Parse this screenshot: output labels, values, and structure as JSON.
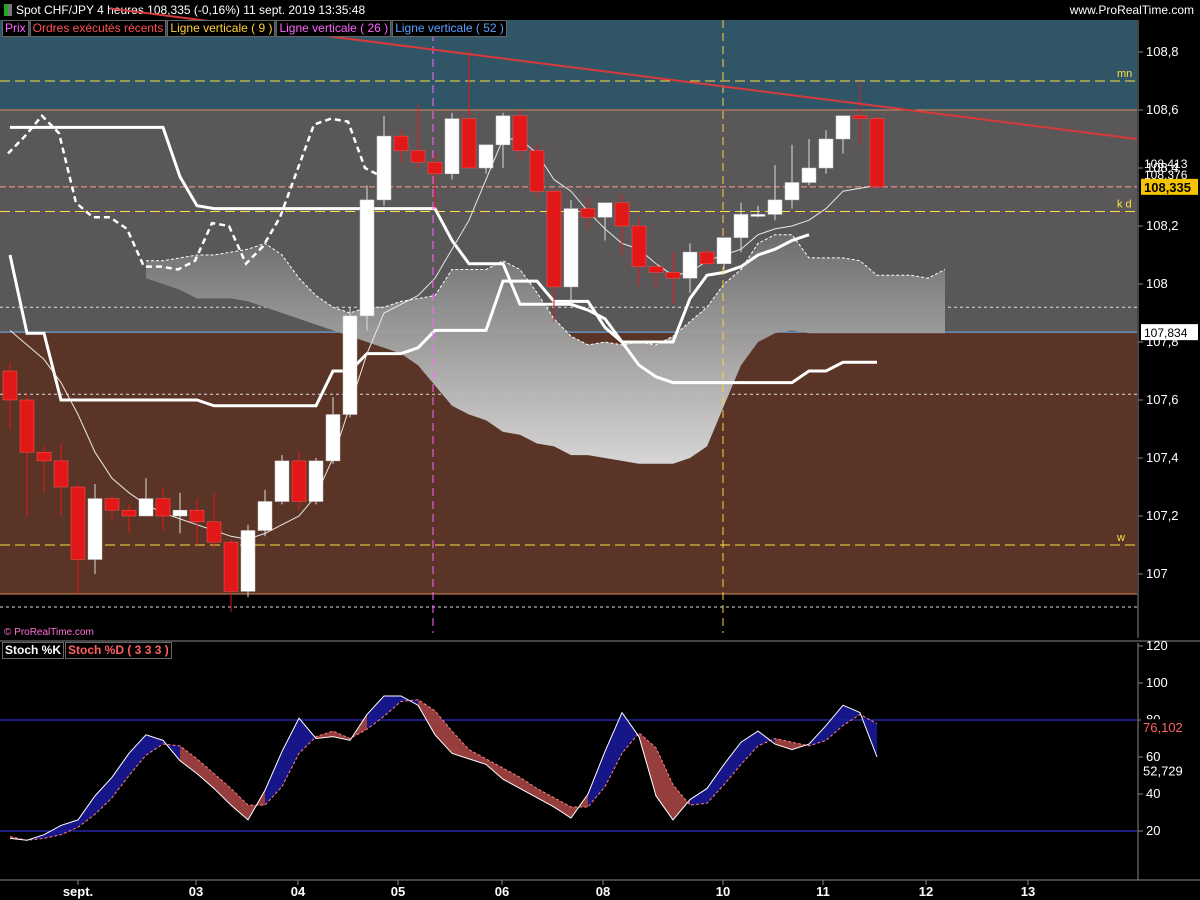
{
  "header": {
    "title": "Spot CHF/JPY   4 heures   108,335 (-0,16%)   11 sept. 2019 13:35:48",
    "site": "www.ProRealTime.com"
  },
  "legend": [
    {
      "label": "Prix",
      "color": "#ff66ff"
    },
    {
      "label": "Ordres exécutés récents",
      "color": "#ff5050"
    },
    {
      "label": "Ligne verticale ( 9 )",
      "color": "#ffd23c"
    },
    {
      "label": "Ligne verticale ( 26 )",
      "color": "#ff66ff"
    },
    {
      "label": "Ligne verticale ( 52 )",
      "color": "#5aa0ff"
    }
  ],
  "stoch_legend": [
    {
      "label": "Stoch %K",
      "color": "#ffffff"
    },
    {
      "label": "Stoch %D ( 3 3 3 )",
      "color": "#ff6060"
    }
  ],
  "copyright": "© ProRealTime.com",
  "colors": {
    "zone_top": "#2f5567",
    "zone_mid": "#595757",
    "zone_low": "#5a3426",
    "bull": "#ffffff",
    "bear": "#e21818",
    "trend": "#d83a3a"
  },
  "chart_data": [
    {
      "type": "candlestick",
      "title": "Spot CHF/JPY 4 heures",
      "ylim": [
        106.75,
        108.96
      ],
      "yticks": [
        "108,8",
        "108,6",
        "108,4",
        "108,2",
        "108",
        "107,8",
        "107,6",
        "107,4",
        "107,2",
        "107"
      ],
      "xticks": [
        "sept.",
        "03",
        "04",
        "05",
        "06",
        "08",
        "10",
        "11",
        "12",
        "13"
      ],
      "candles": [
        [
          107.7,
          107.73,
          107.5,
          107.6
        ],
        [
          107.6,
          107.62,
          107.2,
          107.42
        ],
        [
          107.42,
          107.44,
          107.28,
          107.39
        ],
        [
          107.39,
          107.45,
          107.2,
          107.3
        ],
        [
          107.3,
          107.31,
          106.93,
          107.05
        ],
        [
          107.05,
          107.31,
          107.0,
          107.26
        ],
        [
          107.26,
          107.27,
          107.18,
          107.22
        ],
        [
          107.22,
          107.24,
          107.14,
          107.2
        ],
        [
          107.2,
          107.33,
          107.2,
          107.26
        ],
        [
          107.26,
          107.3,
          107.15,
          107.2
        ],
        [
          107.2,
          107.28,
          107.14,
          107.22
        ],
        [
          107.22,
          107.26,
          107.1,
          107.18
        ],
        [
          107.18,
          107.28,
          107.09,
          107.11
        ],
        [
          107.11,
          107.12,
          106.87,
          106.94
        ],
        [
          106.94,
          107.17,
          106.92,
          107.15
        ],
        [
          107.15,
          107.29,
          107.13,
          107.25
        ],
        [
          107.25,
          107.41,
          107.24,
          107.39
        ],
        [
          107.39,
          107.42,
          107.22,
          107.25
        ],
        [
          107.25,
          107.4,
          107.24,
          107.39
        ],
        [
          107.39,
          107.61,
          107.38,
          107.55
        ],
        [
          107.55,
          107.92,
          107.54,
          107.89
        ],
        [
          107.89,
          108.34,
          107.84,
          108.29
        ],
        [
          108.29,
          108.58,
          108.27,
          108.51
        ],
        [
          108.51,
          108.53,
          108.42,
          108.46
        ],
        [
          108.46,
          108.62,
          108.4,
          108.42
        ],
        [
          108.42,
          108.45,
          108.26,
          108.38
        ],
        [
          108.38,
          108.59,
          108.36,
          108.57
        ],
        [
          108.57,
          108.81,
          108.41,
          108.4
        ],
        [
          108.4,
          108.48,
          108.38,
          108.48
        ],
        [
          108.48,
          108.59,
          108.4,
          108.58
        ],
        [
          108.58,
          108.6,
          108.43,
          108.46
        ],
        [
          108.46,
          108.48,
          108.3,
          108.32
        ],
        [
          108.32,
          108.33,
          107.87,
          107.99
        ],
        [
          107.99,
          108.29,
          107.94,
          108.26
        ],
        [
          108.26,
          108.3,
          108.19,
          108.23
        ],
        [
          108.23,
          108.28,
          108.15,
          108.28
        ],
        [
          108.28,
          108.31,
          108.1,
          108.2
        ],
        [
          108.2,
          108.23,
          107.99,
          108.06
        ],
        [
          108.06,
          108.07,
          107.99,
          108.04
        ],
        [
          108.04,
          108.11,
          107.93,
          108.02
        ],
        [
          108.02,
          108.14,
          107.97,
          108.11
        ],
        [
          108.11,
          108.12,
          108.06,
          108.07
        ],
        [
          108.07,
          108.16,
          108.05,
          108.16
        ],
        [
          108.16,
          108.28,
          108.11,
          108.24
        ],
        [
          108.24,
          108.27,
          108.23,
          108.24
        ],
        [
          108.24,
          108.41,
          108.22,
          108.29
        ],
        [
          108.29,
          108.48,
          108.26,
          108.35
        ],
        [
          108.35,
          108.5,
          108.34,
          108.4
        ],
        [
          108.4,
          108.53,
          108.38,
          108.5
        ],
        [
          108.5,
          108.58,
          108.45,
          108.58
        ],
        [
          108.58,
          108.7,
          108.48,
          108.57
        ],
        [
          108.57,
          108.58,
          108.33,
          108.335
        ]
      ],
      "levels": [
        {
          "label": "mn",
          "value": 108.7,
          "color": "#ffe040"
        },
        {
          "label": "k d",
          "value": 108.25,
          "color": "#ffe040"
        },
        {
          "label": "w",
          "value": 107.1,
          "color": "#ffe040"
        }
      ],
      "current_price": 108.335,
      "price_labels": [
        "108,413",
        "108,376",
        "108,335",
        "107,834"
      ]
    },
    {
      "type": "line",
      "title": "Stoch %K / Stoch %D ( 3 3 3 )",
      "ylim": [
        0,
        130
      ],
      "yticks": [
        "120",
        "100",
        "80",
        "60",
        "40",
        "20"
      ],
      "bands": [
        80,
        20
      ],
      "series": [
        {
          "name": "Stoch %K",
          "values": [
            16,
            15,
            18,
            23,
            26,
            39,
            49,
            62,
            72,
            69,
            58,
            51,
            43,
            34,
            26,
            42,
            63,
            81,
            70,
            71,
            69,
            83,
            93,
            93,
            88,
            72,
            62,
            59,
            56,
            48,
            43,
            38,
            33,
            27,
            40,
            63,
            84,
            71,
            39,
            26,
            37,
            43,
            56,
            68,
            74,
            67,
            64,
            67,
            77,
            88,
            84,
            60
          ]
        },
        {
          "name": "Stoch %D ( 3 3 3 )",
          "values": [
            17,
            15,
            16,
            18,
            22,
            29,
            38,
            50,
            61,
            67,
            66,
            59,
            51,
            43,
            34,
            34,
            44,
            62,
            71,
            74,
            70,
            75,
            82,
            90,
            91,
            85,
            74,
            64,
            59,
            54,
            49,
            43,
            38,
            33,
            33,
            44,
            62,
            73,
            65,
            45,
            34,
            35,
            45,
            56,
            66,
            70,
            68,
            66,
            69,
            77,
            83,
            78
          ]
        }
      ],
      "value_labels": [
        "76,102",
        "52,729"
      ]
    }
  ]
}
